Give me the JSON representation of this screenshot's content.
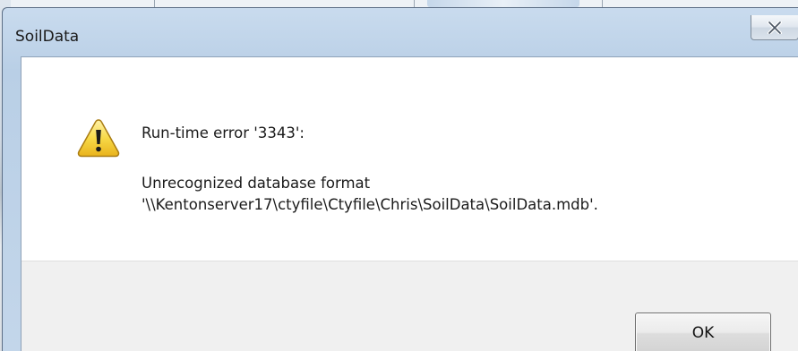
{
  "window": {
    "title": "SoilData",
    "close_icon": "close-x-icon"
  },
  "message": {
    "icon": "warning-icon",
    "title": "Run-time error '3343':",
    "line1": "Unrecognized database format",
    "line2": "'\\\\Kentonserver17\\ctyfile\\Ctyfile\\Chris\\SoilData\\SoilData.mdb'."
  },
  "buttons": {
    "ok_label": "OK"
  },
  "colors": {
    "warning_fill": "#f5d33b",
    "warning_border": "#b8860b",
    "footer_bg": "#f0f0f0"
  }
}
